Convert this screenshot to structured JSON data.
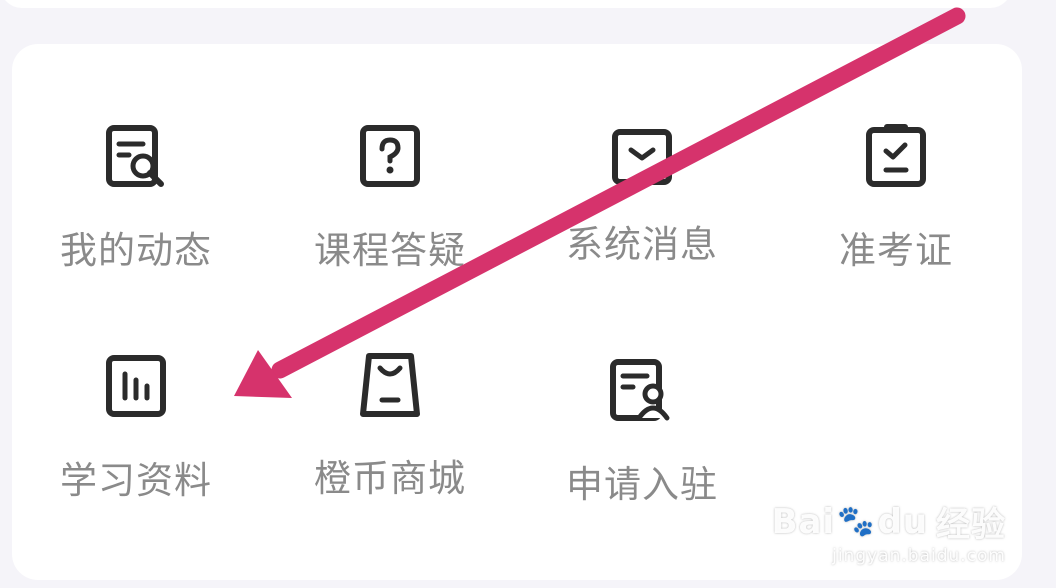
{
  "menu": {
    "items": [
      {
        "label": "我的动态",
        "icon": "document-search-icon"
      },
      {
        "label": "课程答疑",
        "icon": "question-icon"
      },
      {
        "label": "系统消息",
        "icon": "message-icon"
      },
      {
        "label": "准考证",
        "icon": "clipboard-check-icon"
      },
      {
        "label": "学习资料",
        "icon": "chart-bars-icon"
      },
      {
        "label": "橙币商城",
        "icon": "shopping-bag-icon"
      },
      {
        "label": "申请入驻",
        "icon": "document-user-icon"
      }
    ]
  },
  "annotation": {
    "color": "#d6336c",
    "icon": "arrow-icon"
  },
  "watermark": {
    "brand_latin": "Bai",
    "brand_du": "du",
    "brand_cn": "经验",
    "url": "jingyan.baidu.com"
  }
}
